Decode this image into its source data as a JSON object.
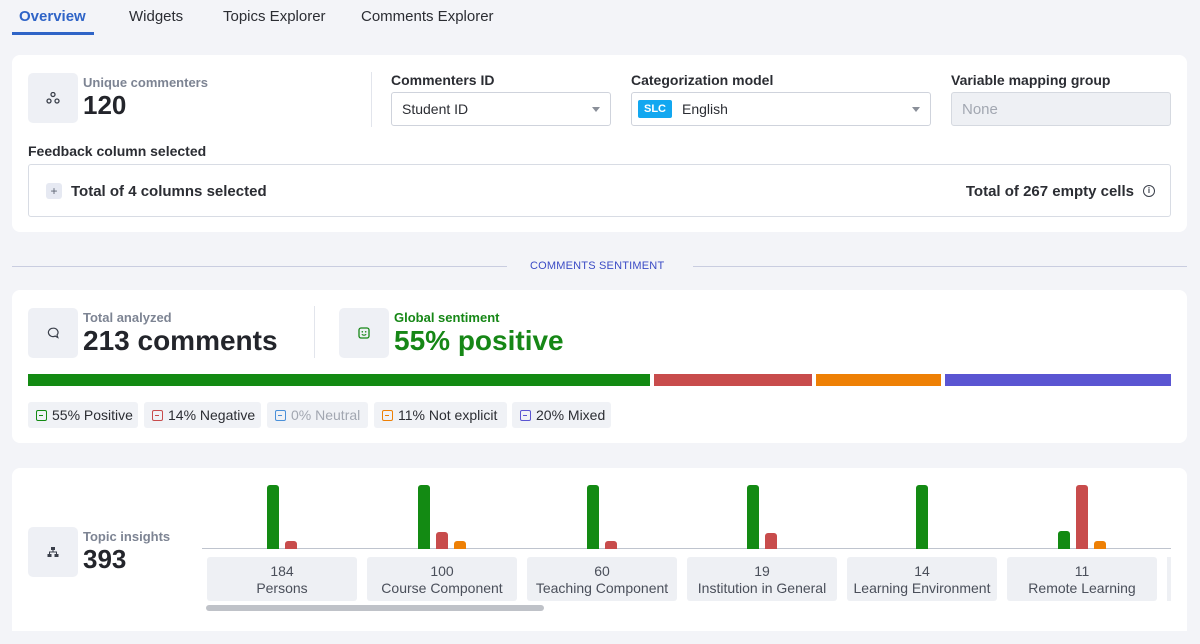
{
  "tabs": [
    {
      "label": "Overview"
    },
    {
      "label": "Widgets"
    },
    {
      "label": "Topics Explorer"
    },
    {
      "label": "Comments Explorer"
    }
  ],
  "config": {
    "unique_commenters_label": "Unique commenters",
    "unique_commenters_value": "120",
    "commenters_id_label": "Commenters ID",
    "commenters_id_value": "Student ID",
    "categorization_label": "Categorization model",
    "categorization_badge": "SLC",
    "categorization_value": "English",
    "variable_mapping_label": "Variable mapping group",
    "variable_mapping_value": "None",
    "feedback_label": "Feedback column selected",
    "columns_selected": "Total of 4 columns selected",
    "empty_cells": "Total of 267 empty cells"
  },
  "section_title": "COMMENTS SENTIMENT",
  "sentiment": {
    "total_label": "Total analyzed",
    "total_value": "213 comments",
    "global_label": "Global sentiment",
    "global_value": "55% positive",
    "bar": [
      {
        "name": "Positive",
        "percent": 55,
        "color": "#138a13"
      },
      {
        "name": "Negative",
        "percent": 14,
        "color": "#c84c4c"
      },
      {
        "name": "Neutral",
        "percent": 0,
        "color": "#4a90d9"
      },
      {
        "name": "Not explicit",
        "percent": 11,
        "color": "#ee8005"
      },
      {
        "name": "Mixed",
        "percent": 20,
        "color": "#5a55d2"
      }
    ],
    "chips": [
      {
        "label": "55% Positive",
        "color": "#138a13"
      },
      {
        "label": "14% Negative",
        "color": "#c84c4c"
      },
      {
        "label": "0% Neutral",
        "color": "#4a90d9"
      },
      {
        "label": "11% Not explicit",
        "color": "#ee8005"
      },
      {
        "label": "20% Mixed",
        "color": "#5a55d2"
      }
    ]
  },
  "topics": {
    "label": "Topic insights",
    "value": "393",
    "items": [
      {
        "count": "184",
        "name": "Persons"
      },
      {
        "count": "100",
        "name": "Course Component"
      },
      {
        "count": "60",
        "name": "Teaching Component"
      },
      {
        "count": "19",
        "name": "Institution in General"
      },
      {
        "count": "14",
        "name": "Learning Environment"
      },
      {
        "count": "11",
        "name": "Remote Learning"
      }
    ]
  }
}
